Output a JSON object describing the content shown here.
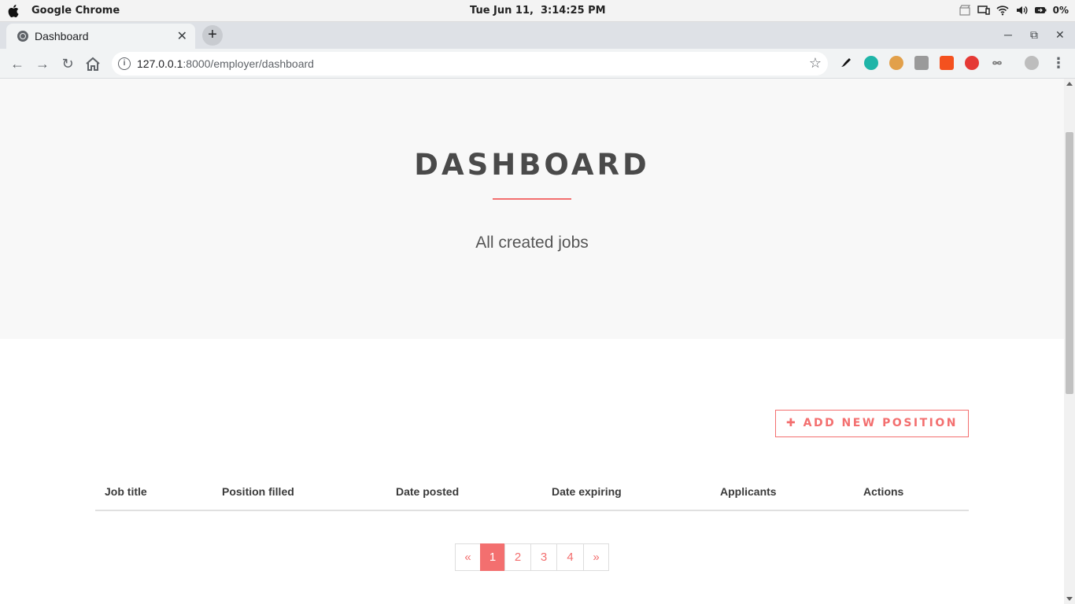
{
  "os": {
    "app_name": "Google Chrome",
    "clock": "Tue Jun 11,  3:14:25 PM",
    "battery": "0%",
    "tray_icons": [
      "clapper-icon",
      "display-icon",
      "wifi-icon",
      "volume-icon",
      "battery-icon"
    ]
  },
  "browser": {
    "tab_title": "Dashboard",
    "tab_close": "✕",
    "new_tab": "+",
    "url_host": "127.0.0.1",
    "url_rest": ":8000/employer/dashboard",
    "extensions": [
      "brush-extension-icon",
      "m-extension-icon",
      "cookie-extension-icon",
      "puzzle-extension-icon",
      "gear-extension-icon",
      "tv-extension-icon",
      "infinity-extension-icon"
    ]
  },
  "hero": {
    "title": "DASHBOARD",
    "subtitle": "All created jobs",
    "accent_color": "#f36f6f"
  },
  "actions": {
    "add_label": "ADD NEW POSITION"
  },
  "table": {
    "headers": [
      "Job title",
      "Position filled",
      "Date posted",
      "Date expiring",
      "Applicants",
      "Actions"
    ],
    "rows": []
  },
  "pagination": {
    "prev": "«",
    "pages": [
      "1",
      "2",
      "3",
      "4"
    ],
    "active": "1",
    "next": "»"
  }
}
